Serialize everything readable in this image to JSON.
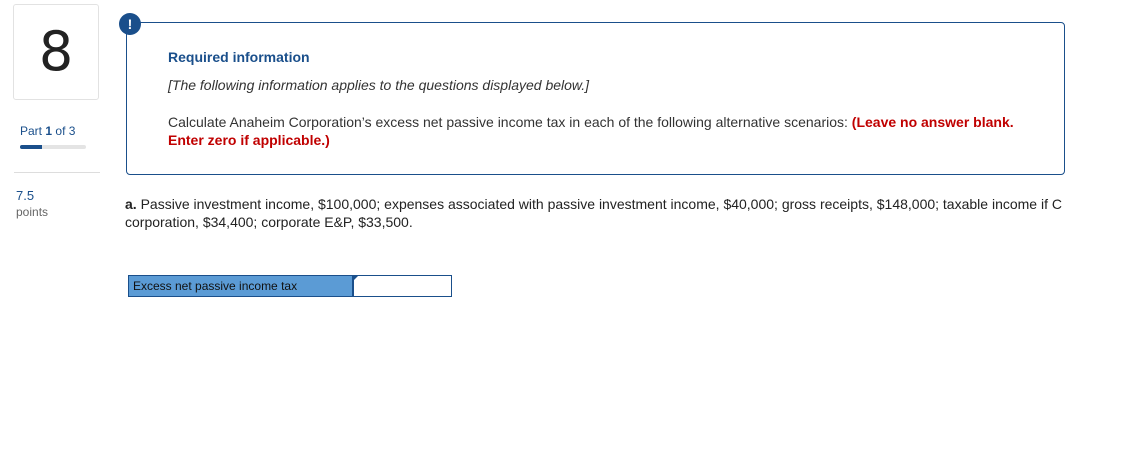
{
  "question": {
    "number": "8",
    "part_label": "Part",
    "part_current": "1",
    "part_of": "of 3",
    "progress_fraction": 0.33,
    "points_value": "7.5",
    "points_label": "points"
  },
  "info": {
    "alert_symbol": "!",
    "title": "Required information",
    "note": "[The following information applies to the questions displayed below.]",
    "instruction": "Calculate Anaheim Corporation’s excess net passive income tax in each of the following alternative scenarios:",
    "instruction_emphasis": "(Leave no answer blank. Enter zero if applicable.)"
  },
  "scenario": {
    "lead": "a.",
    "text": "Passive investment income, $100,000; expenses associated with passive investment income, $40,000; gross receipts, $148,000; taxable income if C corporation, $34,400; corporate E&P, $33,500."
  },
  "answer": {
    "label": "Excess net passive income tax",
    "value": ""
  },
  "colors": {
    "accent": "#1a4f8b",
    "emphasis_red": "#c00000",
    "label_fill": "#5b9bd5"
  }
}
